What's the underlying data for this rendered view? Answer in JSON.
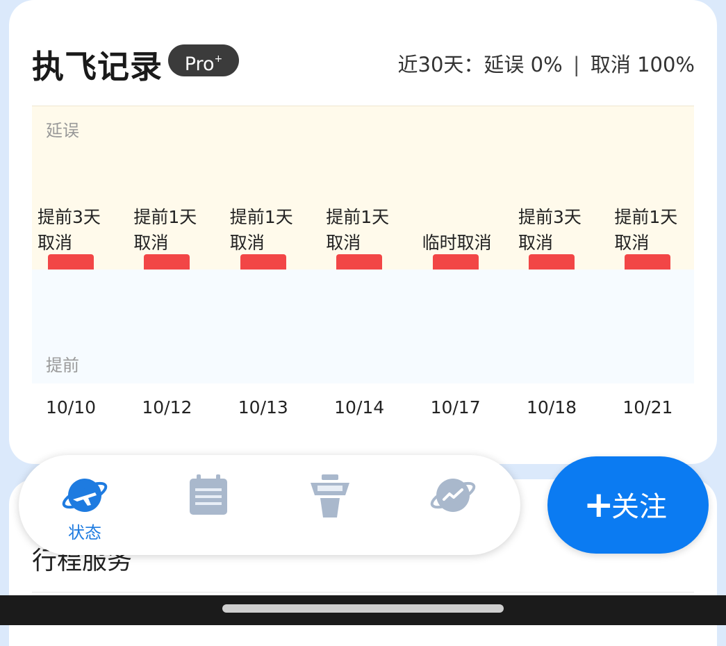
{
  "header": {
    "title": "执飞记录",
    "badge": "Pro",
    "badge_mark": "+",
    "stats_prefix": "近30天：延误 0%",
    "stats_sep": "|",
    "stats_suffix": "取消 100%"
  },
  "chart_data": {
    "type": "bar",
    "band_top_label": "延误",
    "band_bottom_label": "提前",
    "categories": [
      "10/10",
      "10/12",
      "10/13",
      "10/14",
      "10/17",
      "10/18",
      "10/21"
    ],
    "status_labels": [
      "提前3天\n取消",
      "提前1天\n取消",
      "提前1天\n取消",
      "提前1天\n取消",
      "临时取消",
      "提前3天\n取消",
      "提前1天\n取消"
    ],
    "bar_color": "#f24646"
  },
  "tabs": [
    {
      "icon": "plane-globe-icon",
      "label": "状态",
      "active": true
    },
    {
      "icon": "calendar-icon",
      "label": ""
    },
    {
      "icon": "control-tower-icon",
      "label": ""
    },
    {
      "icon": "trend-globe-icon",
      "label": ""
    }
  ],
  "fab": {
    "plus": "+",
    "label": "关注"
  },
  "section2": {
    "title": "行程服务"
  },
  "colors": {
    "accent": "#0b7bf2",
    "active_tab": "#1e7be0",
    "inactive_tab": "#a9b8cc",
    "delay_band": "#fffaeb",
    "early_band": "#f6fbff"
  }
}
